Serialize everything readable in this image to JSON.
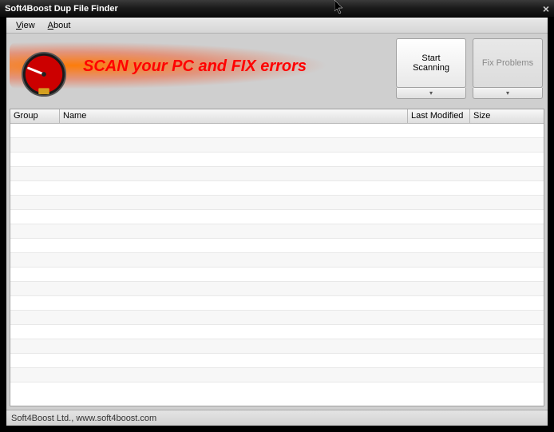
{
  "title": "Soft4Boost Dup File Finder",
  "menu": {
    "view": "View",
    "about": "About"
  },
  "slogan": "SCAN your PC and FIX errors",
  "buttons": {
    "scan": "Start\nScanning",
    "fix": "Fix Problems"
  },
  "columns": {
    "group": "Group",
    "name": "Name",
    "modified": "Last Modified",
    "size": "Size"
  },
  "rows": [],
  "status": "Soft4Boost Ltd., www.soft4boost.com"
}
